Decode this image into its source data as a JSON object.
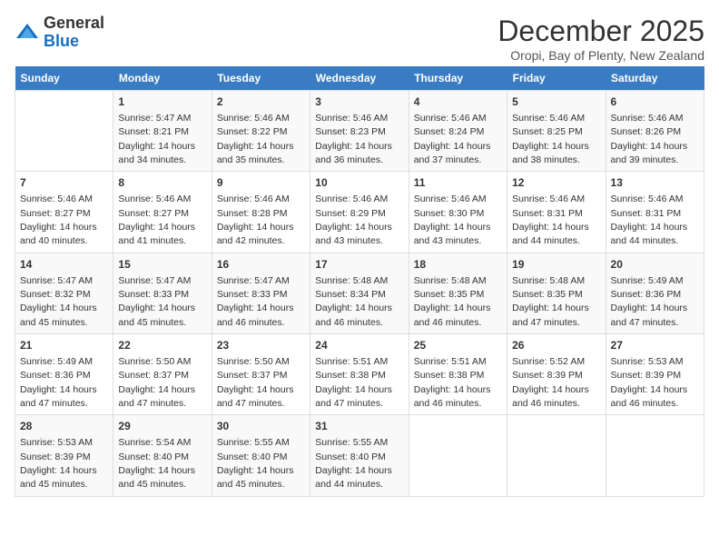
{
  "header": {
    "logo_general": "General",
    "logo_blue": "Blue",
    "month_title": "December 2025",
    "subtitle": "Oropi, Bay of Plenty, New Zealand"
  },
  "days_of_week": [
    "Sunday",
    "Monday",
    "Tuesday",
    "Wednesday",
    "Thursday",
    "Friday",
    "Saturday"
  ],
  "weeks": [
    [
      {
        "num": "",
        "sunrise": "",
        "sunset": "",
        "daylight": ""
      },
      {
        "num": "1",
        "sunrise": "Sunrise: 5:47 AM",
        "sunset": "Sunset: 8:21 PM",
        "daylight": "Daylight: 14 hours and 34 minutes."
      },
      {
        "num": "2",
        "sunrise": "Sunrise: 5:46 AM",
        "sunset": "Sunset: 8:22 PM",
        "daylight": "Daylight: 14 hours and 35 minutes."
      },
      {
        "num": "3",
        "sunrise": "Sunrise: 5:46 AM",
        "sunset": "Sunset: 8:23 PM",
        "daylight": "Daylight: 14 hours and 36 minutes."
      },
      {
        "num": "4",
        "sunrise": "Sunrise: 5:46 AM",
        "sunset": "Sunset: 8:24 PM",
        "daylight": "Daylight: 14 hours and 37 minutes."
      },
      {
        "num": "5",
        "sunrise": "Sunrise: 5:46 AM",
        "sunset": "Sunset: 8:25 PM",
        "daylight": "Daylight: 14 hours and 38 minutes."
      },
      {
        "num": "6",
        "sunrise": "Sunrise: 5:46 AM",
        "sunset": "Sunset: 8:26 PM",
        "daylight": "Daylight: 14 hours and 39 minutes."
      }
    ],
    [
      {
        "num": "7",
        "sunrise": "Sunrise: 5:46 AM",
        "sunset": "Sunset: 8:27 PM",
        "daylight": "Daylight: 14 hours and 40 minutes."
      },
      {
        "num": "8",
        "sunrise": "Sunrise: 5:46 AM",
        "sunset": "Sunset: 8:27 PM",
        "daylight": "Daylight: 14 hours and 41 minutes."
      },
      {
        "num": "9",
        "sunrise": "Sunrise: 5:46 AM",
        "sunset": "Sunset: 8:28 PM",
        "daylight": "Daylight: 14 hours and 42 minutes."
      },
      {
        "num": "10",
        "sunrise": "Sunrise: 5:46 AM",
        "sunset": "Sunset: 8:29 PM",
        "daylight": "Daylight: 14 hours and 43 minutes."
      },
      {
        "num": "11",
        "sunrise": "Sunrise: 5:46 AM",
        "sunset": "Sunset: 8:30 PM",
        "daylight": "Daylight: 14 hours and 43 minutes."
      },
      {
        "num": "12",
        "sunrise": "Sunrise: 5:46 AM",
        "sunset": "Sunset: 8:31 PM",
        "daylight": "Daylight: 14 hours and 44 minutes."
      },
      {
        "num": "13",
        "sunrise": "Sunrise: 5:46 AM",
        "sunset": "Sunset: 8:31 PM",
        "daylight": "Daylight: 14 hours and 44 minutes."
      }
    ],
    [
      {
        "num": "14",
        "sunrise": "Sunrise: 5:47 AM",
        "sunset": "Sunset: 8:32 PM",
        "daylight": "Daylight: 14 hours and 45 minutes."
      },
      {
        "num": "15",
        "sunrise": "Sunrise: 5:47 AM",
        "sunset": "Sunset: 8:33 PM",
        "daylight": "Daylight: 14 hours and 45 minutes."
      },
      {
        "num": "16",
        "sunrise": "Sunrise: 5:47 AM",
        "sunset": "Sunset: 8:33 PM",
        "daylight": "Daylight: 14 hours and 46 minutes."
      },
      {
        "num": "17",
        "sunrise": "Sunrise: 5:48 AM",
        "sunset": "Sunset: 8:34 PM",
        "daylight": "Daylight: 14 hours and 46 minutes."
      },
      {
        "num": "18",
        "sunrise": "Sunrise: 5:48 AM",
        "sunset": "Sunset: 8:35 PM",
        "daylight": "Daylight: 14 hours and 46 minutes."
      },
      {
        "num": "19",
        "sunrise": "Sunrise: 5:48 AM",
        "sunset": "Sunset: 8:35 PM",
        "daylight": "Daylight: 14 hours and 47 minutes."
      },
      {
        "num": "20",
        "sunrise": "Sunrise: 5:49 AM",
        "sunset": "Sunset: 8:36 PM",
        "daylight": "Daylight: 14 hours and 47 minutes."
      }
    ],
    [
      {
        "num": "21",
        "sunrise": "Sunrise: 5:49 AM",
        "sunset": "Sunset: 8:36 PM",
        "daylight": "Daylight: 14 hours and 47 minutes."
      },
      {
        "num": "22",
        "sunrise": "Sunrise: 5:50 AM",
        "sunset": "Sunset: 8:37 PM",
        "daylight": "Daylight: 14 hours and 47 minutes."
      },
      {
        "num": "23",
        "sunrise": "Sunrise: 5:50 AM",
        "sunset": "Sunset: 8:37 PM",
        "daylight": "Daylight: 14 hours and 47 minutes."
      },
      {
        "num": "24",
        "sunrise": "Sunrise: 5:51 AM",
        "sunset": "Sunset: 8:38 PM",
        "daylight": "Daylight: 14 hours and 47 minutes."
      },
      {
        "num": "25",
        "sunrise": "Sunrise: 5:51 AM",
        "sunset": "Sunset: 8:38 PM",
        "daylight": "Daylight: 14 hours and 46 minutes."
      },
      {
        "num": "26",
        "sunrise": "Sunrise: 5:52 AM",
        "sunset": "Sunset: 8:39 PM",
        "daylight": "Daylight: 14 hours and 46 minutes."
      },
      {
        "num": "27",
        "sunrise": "Sunrise: 5:53 AM",
        "sunset": "Sunset: 8:39 PM",
        "daylight": "Daylight: 14 hours and 46 minutes."
      }
    ],
    [
      {
        "num": "28",
        "sunrise": "Sunrise: 5:53 AM",
        "sunset": "Sunset: 8:39 PM",
        "daylight": "Daylight: 14 hours and 45 minutes."
      },
      {
        "num": "29",
        "sunrise": "Sunrise: 5:54 AM",
        "sunset": "Sunset: 8:40 PM",
        "daylight": "Daylight: 14 hours and 45 minutes."
      },
      {
        "num": "30",
        "sunrise": "Sunrise: 5:55 AM",
        "sunset": "Sunset: 8:40 PM",
        "daylight": "Daylight: 14 hours and 45 minutes."
      },
      {
        "num": "31",
        "sunrise": "Sunrise: 5:55 AM",
        "sunset": "Sunset: 8:40 PM",
        "daylight": "Daylight: 14 hours and 44 minutes."
      },
      {
        "num": "",
        "sunrise": "",
        "sunset": "",
        "daylight": ""
      },
      {
        "num": "",
        "sunrise": "",
        "sunset": "",
        "daylight": ""
      },
      {
        "num": "",
        "sunrise": "",
        "sunset": "",
        "daylight": ""
      }
    ]
  ]
}
